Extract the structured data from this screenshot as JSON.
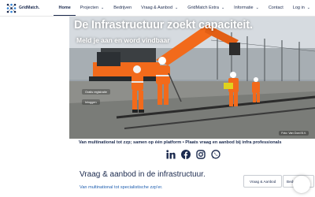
{
  "nav": {
    "logo_text": "GridMatch.",
    "items": [
      {
        "label": "Home"
      },
      {
        "label": "Projecten"
      },
      {
        "label": "Bedrijven"
      },
      {
        "label": "Vraag & Aanbod"
      },
      {
        "label": "GridMatch Extra"
      },
      {
        "label": "Informatie"
      },
      {
        "label": "Contact"
      },
      {
        "label": "Log in"
      }
    ]
  },
  "hero": {
    "title": "De Infrastructuur zoekt capaciteit.",
    "subtitle": "Meld je aan en word vindbaar",
    "button1": "Gratis registratie",
    "button2": "Inloggen",
    "credit": "Foto: Van Oord B.V."
  },
  "ticker": "Van multinational tot zzp; samen op één platform  •  Plaats vraag en aanbod bij infra professionals",
  "social": [
    "linkedin-icon",
    "facebook-icon",
    "instagram-icon",
    "whatsapp-icon"
  ],
  "section": {
    "title": "Vraag & aanbod in de infrastructuur.",
    "subtitle": "Van multinational tot specialistische zzp'er.",
    "pill1": "Vraag & Aanbod",
    "pill2": "Bedrij"
  },
  "colors": {
    "brand": "#1b2a4e",
    "link": "#1f5fb0",
    "safety_orange": "#f26a1b"
  }
}
